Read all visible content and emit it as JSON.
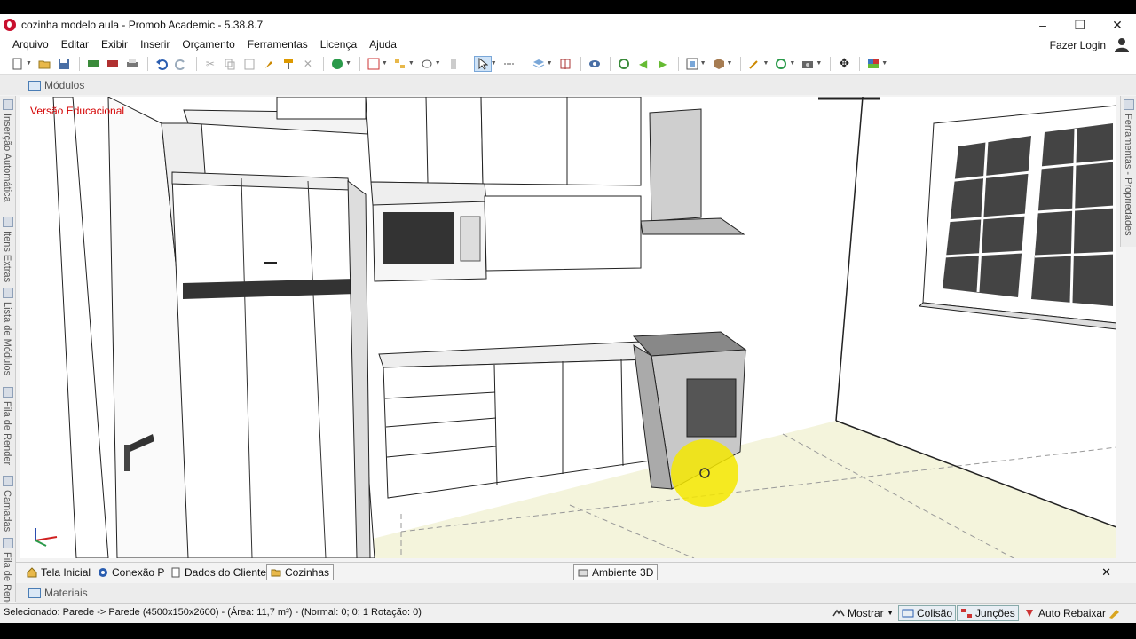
{
  "window": {
    "title": "cozinha modelo aula - Promob Academic - 5.38.8.7",
    "minimize": "–",
    "maximize": "❐",
    "close": "✕"
  },
  "menu": [
    "Arquivo",
    "Editar",
    "Exibir",
    "Inserir",
    "Orçamento",
    "Ferramentas",
    "Licença",
    "Ajuda"
  ],
  "login_label": "Fazer Login",
  "modules_tab": "Módulos",
  "left_dock": [
    "Inserção Automática",
    "Itens Extras",
    "Lista de Módulos",
    "Fila de Render",
    "Camadas",
    "Fila de Rend"
  ],
  "right_dock": "Ferramentas - Propriedades",
  "viewport": {
    "watermark": "Versão Educacional"
  },
  "bottom_tabs": [
    "Tela Inicial",
    "Conexão P",
    "Dados do Cliente",
    "Cozinhas",
    "Ambiente 3D"
  ],
  "close_label": "✕",
  "materials_tab": "Materiais",
  "status": {
    "text": "Selecionado: Parede -> Parede (4500x150x2600) - (Área: 11,7 m²) - (Normal: 0; 0; 1 Rotação: 0)",
    "show": "Mostrar",
    "collision": "Colisão",
    "joints": "Junções",
    "auto_lower": "Auto Rebaixar"
  },
  "colors": {
    "accent": "#3a78c2",
    "watermark": "#d40000",
    "highlight": "#f5e800",
    "floor": "#f4f4dc"
  }
}
